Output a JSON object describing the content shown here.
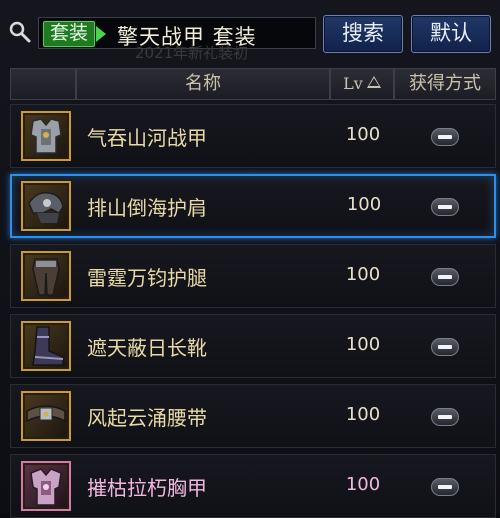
{
  "search": {
    "tag": "套装",
    "query": "擎天战甲  套装",
    "ghost": "2021年新礼装初",
    "search_button": "搜索",
    "default_button": "默认"
  },
  "header": {
    "name": "名称",
    "lv": "Lv",
    "obtain": "获得方式"
  },
  "items": [
    {
      "name": "气吞山河战甲",
      "lv": "100",
      "icon": "chest-armor-icon",
      "rarity": "epic",
      "selected": false
    },
    {
      "name": "排山倒海护肩",
      "lv": "100",
      "icon": "shoulder-armor-icon",
      "rarity": "epic",
      "selected": true
    },
    {
      "name": "雷霆万钧护腿",
      "lv": "100",
      "icon": "leg-armor-icon",
      "rarity": "epic",
      "selected": false
    },
    {
      "name": "遮天蔽日长靴",
      "lv": "100",
      "icon": "boots-icon",
      "rarity": "epic",
      "selected": false
    },
    {
      "name": "风起云涌腰带",
      "lv": "100",
      "icon": "belt-icon",
      "rarity": "epic",
      "selected": false
    },
    {
      "name": "摧枯拉朽胸甲",
      "lv": "100",
      "icon": "breastplate-icon",
      "rarity": "pink",
      "selected": false
    }
  ],
  "colors": {
    "epic_name": "#e8d9a6",
    "pink_name": "#f0b8e0",
    "selected_border": "#2f8fe8",
    "tag_green": "#1f7a22"
  }
}
